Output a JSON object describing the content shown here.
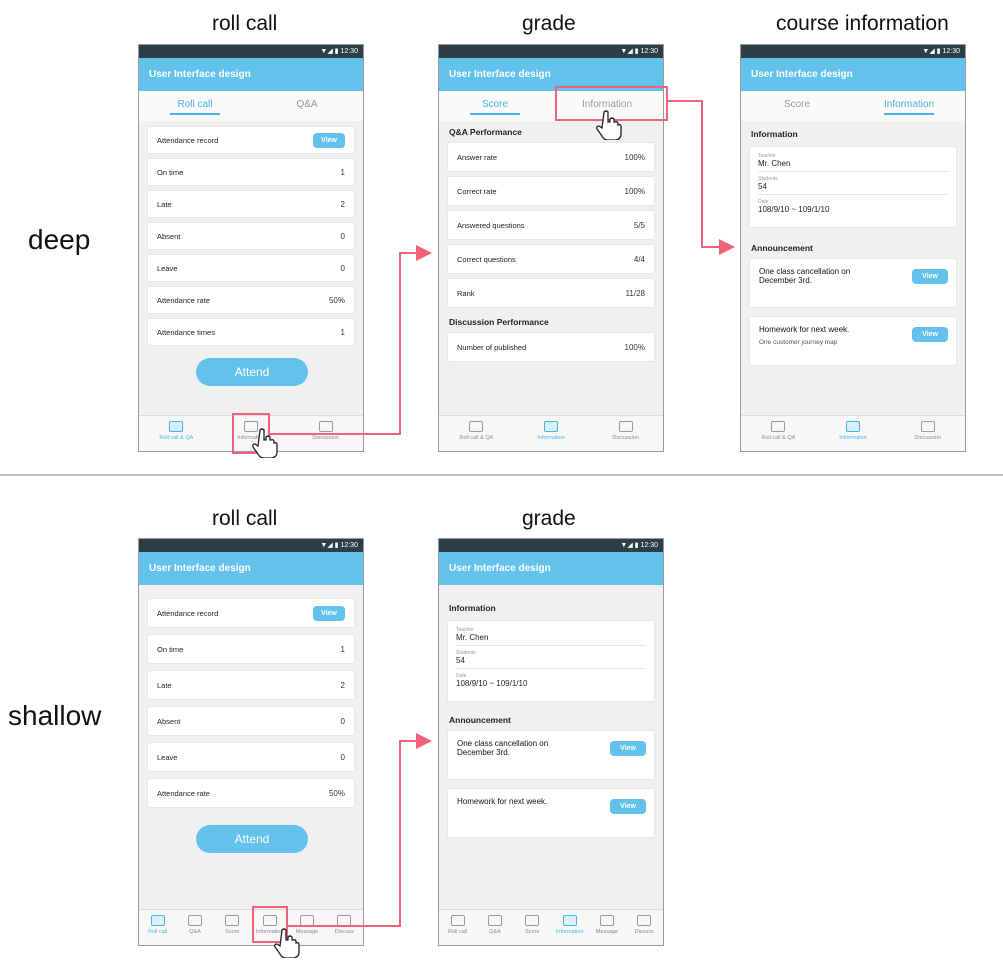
{
  "columns": {
    "roll_call": "roll call",
    "grade": "grade",
    "course_information": "course information"
  },
  "rows": {
    "deep": "deep",
    "shallow": "shallow"
  },
  "status_time": "▼◢ ▮ 12:30",
  "app_title": "User Interface design",
  "roll_call_tabs": [
    "Roll call",
    "Q&A"
  ],
  "grade_tabs": [
    "Score",
    "Information"
  ],
  "deep_roll_call": {
    "rows": [
      {
        "label": "Attendance record",
        "value": "View"
      },
      {
        "label": "On time",
        "value": "1"
      },
      {
        "label": "Late",
        "value": "2"
      },
      {
        "label": "Absent",
        "value": "0"
      },
      {
        "label": "Leave",
        "value": "0"
      },
      {
        "label": "Attendance rate",
        "value": "50%"
      },
      {
        "label": "Attendance times",
        "value": "1"
      }
    ],
    "attend": "Attend",
    "nav": [
      "Roll call & QA",
      "Information",
      "Discussion"
    ]
  },
  "deep_grade": {
    "qa_header": "Q&A Performance",
    "qa_rows": [
      {
        "label": "Answer rate",
        "value": "100%"
      },
      {
        "label": "Correct rate",
        "value": "100%"
      },
      {
        "label": "Answered questions",
        "value": "5/5"
      },
      {
        "label": "Correct questions",
        "value": "4/4"
      },
      {
        "label": "Rank",
        "value": "11/28"
      }
    ],
    "disc_header": "Discussion Performance",
    "disc_rows": [
      {
        "label": "Number of published",
        "value": "100%"
      }
    ],
    "nav": [
      "Roll call & QA",
      "Information",
      "Discussion"
    ]
  },
  "course_info": {
    "info_header": "Information",
    "teacher_label": "Teacher",
    "teacher": "Mr. Chen",
    "students_label": "Students",
    "students": "54",
    "date_label": "Date",
    "date": "108/9/10 ~ 109/1/10",
    "ann_header": "Announcement",
    "announcements": [
      {
        "title": "One class cancellation on December 3rd.",
        "sub": ""
      },
      {
        "title": "Homework for next week.",
        "sub": "One customer journey map"
      }
    ],
    "view": "View",
    "nav": [
      "Roll call & QA",
      "Information",
      "Discussion"
    ]
  },
  "shallow_roll_call": {
    "rows": [
      {
        "label": "Attendance record",
        "value": "View"
      },
      {
        "label": "On time",
        "value": "1"
      },
      {
        "label": "Late",
        "value": "2"
      },
      {
        "label": "Absent",
        "value": "0"
      },
      {
        "label": "Leave",
        "value": "0"
      },
      {
        "label": "Attendance rate",
        "value": "50%"
      }
    ],
    "attend": "Attend",
    "nav": [
      "Roll call",
      "Q&A",
      "Score",
      "Information",
      "Message",
      "Discuss"
    ]
  },
  "shallow_grade": {
    "info_header": "Information",
    "teacher_label": "Teacher",
    "teacher": "Mr. Chen",
    "students_label": "Students",
    "students": "54",
    "date_label": "Date",
    "date": "108/9/10 ~ 109/1/10",
    "ann_header": "Announcement",
    "announcements": [
      {
        "title": "One class cancellation on December 3rd.",
        "sub": ""
      },
      {
        "title": "Homework for next week.",
        "sub": ""
      }
    ],
    "view": "View",
    "nav": [
      "Roll call",
      "Q&A",
      "Score",
      "Information",
      "Message",
      "Discuss"
    ]
  },
  "colors": {
    "accent": "#62c2ec",
    "status_bar": "#2c3e48",
    "highlight": "#f0627a"
  }
}
